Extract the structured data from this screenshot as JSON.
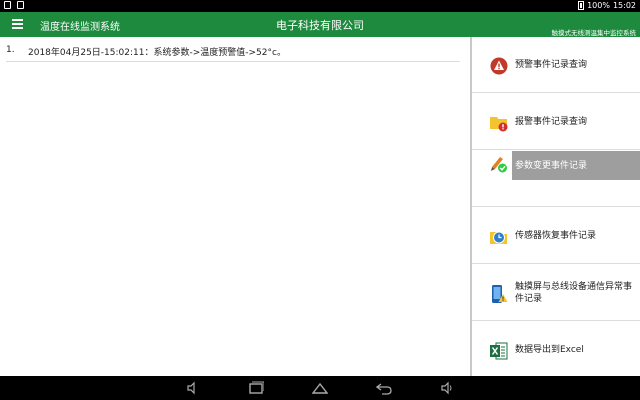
{
  "statusbar": {
    "battery": "100%",
    "time": "15:02"
  },
  "appbar": {
    "title": "温度在线监测系统",
    "company": "电子科技有限公司",
    "system_name": "触摸式无线测温集中监控系统"
  },
  "log": [
    {
      "index": "1.",
      "text": "2018年04月25日-15:02:11：系统参数->温度预警值->52°c。"
    }
  ],
  "sidebar": {
    "items": [
      {
        "label": "预警事件记录查询",
        "icon": "warning-icon"
      },
      {
        "label": "报警事件记录查询",
        "icon": "alarm-folder-icon"
      },
      {
        "label": "参数变更事件记录",
        "icon": "edit-check-icon",
        "selected": true
      },
      {
        "label": "传感器恢复事件记录",
        "icon": "clock-folder-icon"
      },
      {
        "label": "触摸屏与总线设备通信异常事件记录",
        "icon": "device-warning-icon"
      },
      {
        "label": "数据导出到Excel",
        "icon": "excel-icon"
      }
    ]
  },
  "colors": {
    "appbar": "#1e8a3e",
    "selected": "#9e9e9e"
  }
}
